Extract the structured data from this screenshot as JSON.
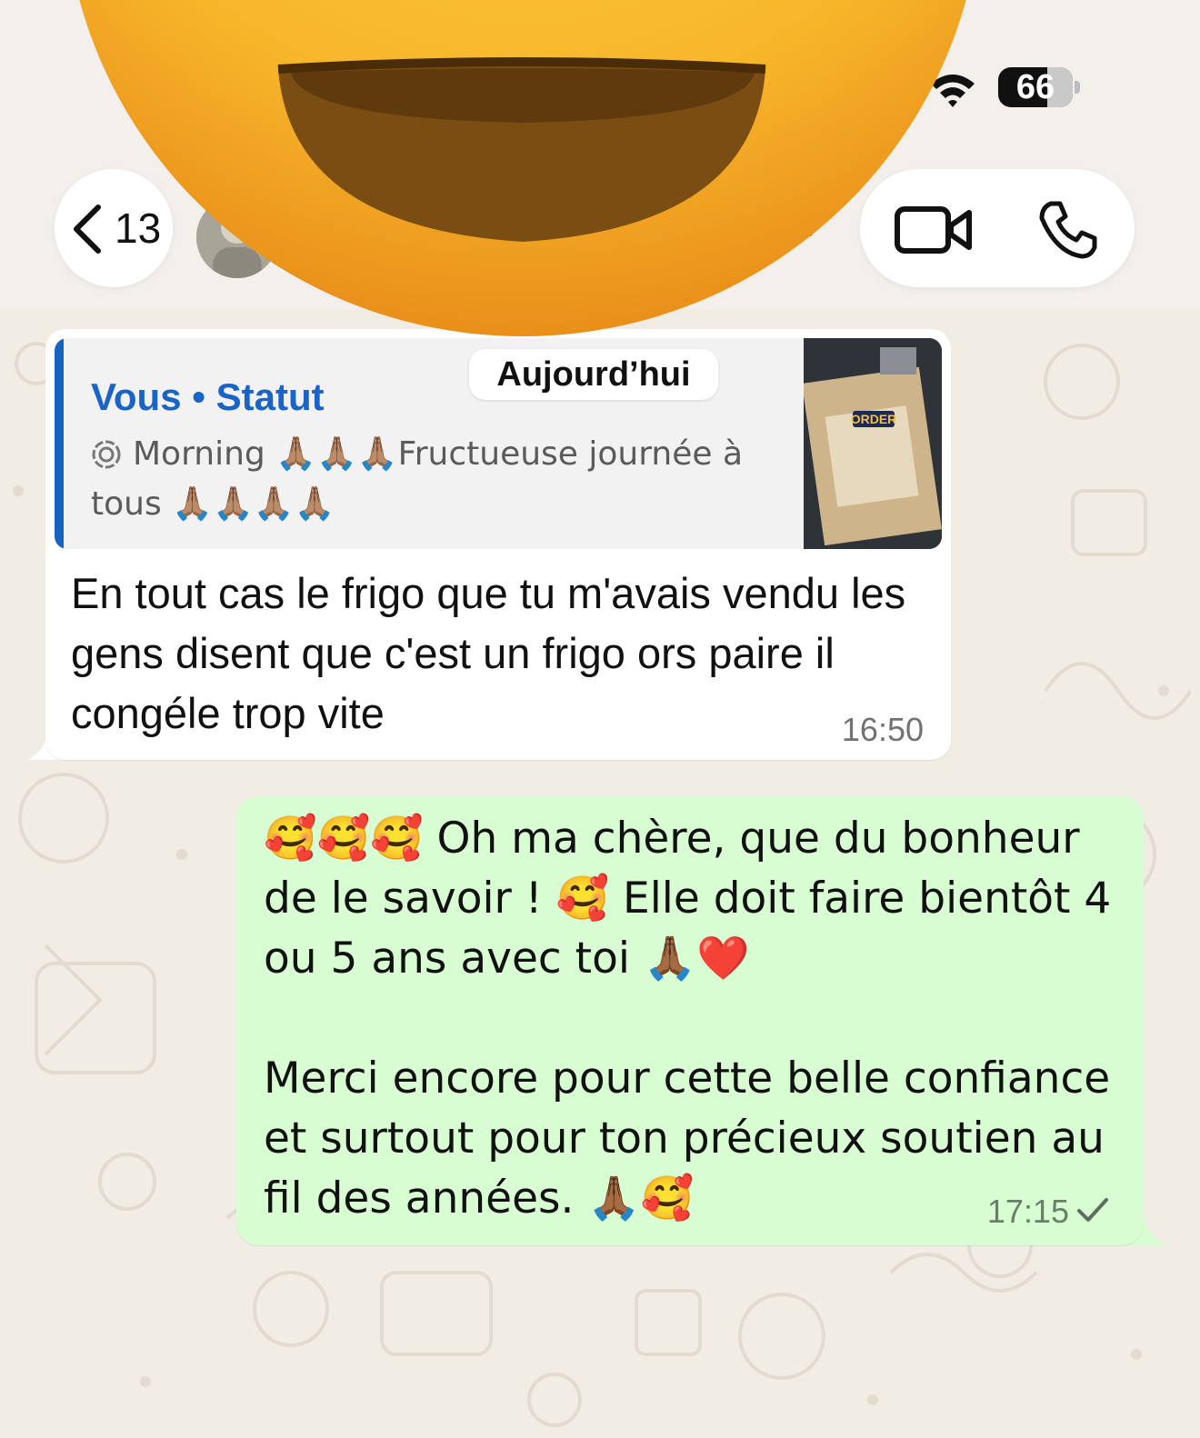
{
  "status_bar": {
    "battery_level": "66",
    "battery_fraction": 0.66
  },
  "header": {
    "back_count": "13"
  },
  "chat": {
    "date_chip": "Aujourd’hui",
    "incoming": {
      "quote_author": "Vous • Statut",
      "quote_text": "Morning 🙏🏽🙏🏽🙏🏽Fructueuse journée à tous 🙏🏽🙏🏽🙏🏽🙏🏽",
      "quote_thumb_label": "ORDER",
      "text": "En tout cas le frigo que tu m'avais vendu les gens disent que c'est un frigo ors paire il congéle trop vite",
      "time": "16:50"
    },
    "outgoing": {
      "text": "🥰🥰🥰 Oh ma chère, que du bonheur de le savoir ! 🥰 Elle doit faire bientôt 4 ou 5 ans avec toi 🙏🏾❤️\n\nMerci encore pour cette belle confiance et surtout pour ton précieux soutien au fil des années. 🙏🏾🥰",
      "time": "17:15",
      "status_icon": "single-check-icon"
    }
  },
  "colors": {
    "outgoing_bubble": "#d8fdd2",
    "incoming_bubble": "#ffffff",
    "quote_accent": "#1565c0",
    "quote_author": "#1a63c7",
    "wallpaper": "#f1ece4"
  }
}
